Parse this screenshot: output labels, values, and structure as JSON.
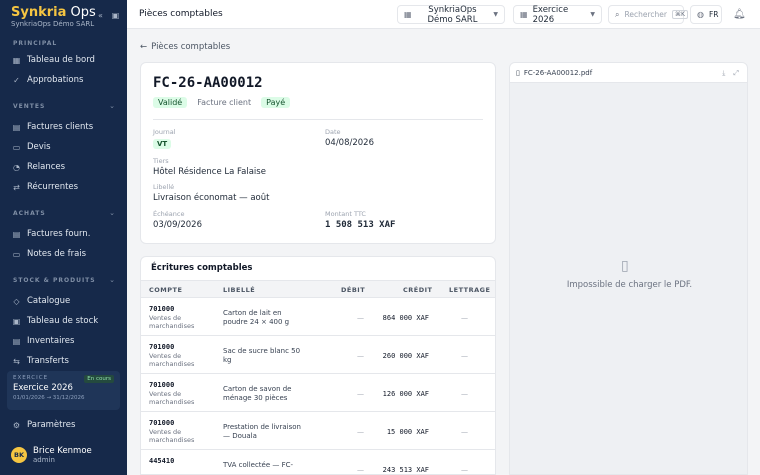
{
  "brand": {
    "name_a": "Synkria",
    "name_b": " Ops",
    "subtitle": "SynkriaOps Démo SARL"
  },
  "sidebar": {
    "sections": [
      {
        "title": "PRINCIPAL"
      },
      {
        "title": "VENTES"
      },
      {
        "title": "ACHATS"
      },
      {
        "title": "STOCK & PRODUITS"
      }
    ],
    "items": [
      {
        "label": "Tableau de bord",
        "icon": "grid-icon"
      },
      {
        "label": "Approbations",
        "icon": "check-circle-icon"
      },
      {
        "label": "Factures clients",
        "icon": "receipt-icon"
      },
      {
        "label": "Devis",
        "icon": "document-icon"
      },
      {
        "label": "Relances",
        "icon": "bell-icon"
      },
      {
        "label": "Récurrentes",
        "icon": "repeat-icon"
      },
      {
        "label": "Factures fourn.",
        "icon": "receipt-icon"
      },
      {
        "label": "Notes de frais",
        "icon": "wallet-icon"
      },
      {
        "label": "Catalogue",
        "icon": "tag-icon"
      },
      {
        "label": "Tableau de stock",
        "icon": "box-icon"
      },
      {
        "label": "Inventaires",
        "icon": "clipboard-icon"
      },
      {
        "label": "Transferts",
        "icon": "swap-icon"
      },
      {
        "label": "Paramètres",
        "icon": "gear-icon"
      }
    ],
    "exercise": {
      "label": "EXERCICE",
      "name": "Exercice 2026",
      "dates": "01/01/2026 → 31/12/2026",
      "badge": "En cours"
    },
    "user": {
      "initials": "BK",
      "name": "Brice Kenmoe",
      "role": "admin"
    }
  },
  "header": {
    "title": "Pièces comptables",
    "company": "SynkriaOps Démo SARL",
    "exercise": "Exercice 2026",
    "search_placeholder": "Rechercher",
    "search_shortcut": "⌘K",
    "lang": "FR"
  },
  "breadcrumb": {
    "back": "Pièces comptables"
  },
  "invoice": {
    "number": "FC-26-AA00012",
    "status": "Validé",
    "type": "Facture client",
    "payment": "Payé",
    "fields": {
      "journal_label": "Journal",
      "journal_value": "VT",
      "date_label": "Date",
      "date_value": "04/08/2026",
      "tiers_label": "Tiers",
      "tiers_value": "Hôtel Résidence La Falaise",
      "libelle_label": "Libellé",
      "libelle_value": "Livraison économat — août",
      "echeance_label": "Échéance",
      "echeance_value": "03/09/2026",
      "montant_label": "Montant TTC",
      "montant_value": "1 508 513 XAF"
    }
  },
  "entries": {
    "title": "Écritures comptables",
    "headers": {
      "compte": "COMPTE",
      "libelle": "LIBELLÉ",
      "debit": "DÉBIT",
      "credit": "CRÉDIT",
      "lettrage": "LETTRAGE"
    },
    "rows": [
      {
        "code": "701000",
        "name": "Ventes de marchandises",
        "libelle": "Carton de lait en poudre 24 × 400 g",
        "debit": "—",
        "credit": "864 000 XAF",
        "lettrage": "—"
      },
      {
        "code": "701000",
        "name": "Ventes de marchandises",
        "libelle": "Sac de sucre blanc 50 kg",
        "debit": "—",
        "credit": "260 000 XAF",
        "lettrage": "—"
      },
      {
        "code": "701000",
        "name": "Ventes de marchandises",
        "libelle": "Carton de savon de ménage 30 pièces",
        "debit": "—",
        "credit": "126 000 XAF",
        "lettrage": "—"
      },
      {
        "code": "701000",
        "name": "Ventes de marchandises",
        "libelle": "Prestation de livraison — Douala",
        "debit": "—",
        "credit": "15 000 XAF",
        "lettrage": "—"
      },
      {
        "code": "445410",
        "name": "",
        "libelle": "TVA collectée — FC-",
        "debit": "—",
        "credit": "243 513 XAF",
        "lettrage": "—"
      }
    ]
  },
  "pdf": {
    "filename": "FC-26-AA00012.pdf",
    "error": "Impossible de charger le PDF."
  }
}
